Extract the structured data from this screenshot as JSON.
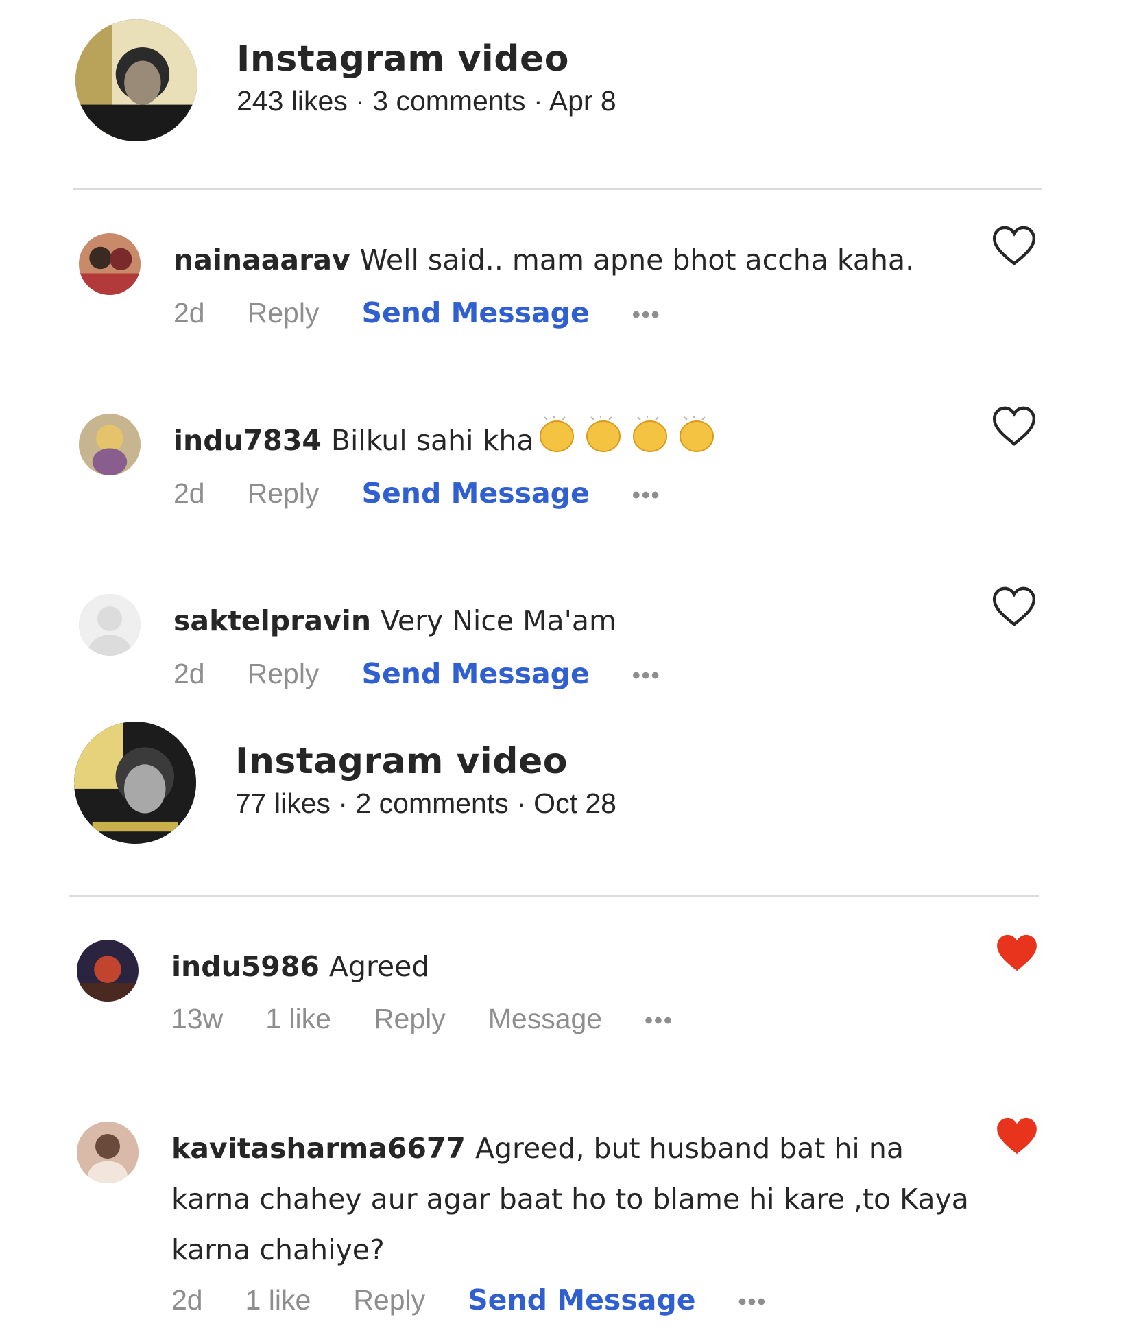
{
  "posts": [
    {
      "title": "Instagram video",
      "meta": "243 likes · 3 comments · Apr 8",
      "comments": [
        {
          "username": "nainaaarav",
          "text": "Well said.. mam apne bhot accha kaha.",
          "time": "2d",
          "likes": "",
          "reply": "Reply",
          "message": "Send Message",
          "more": "•••",
          "liked": false
        },
        {
          "username": "indu7834",
          "text": "Bilkul sahi kha",
          "emoji": "clapping-hands",
          "time": "2d",
          "likes": "",
          "reply": "Reply",
          "message": "Send Message",
          "more": "•••",
          "liked": false
        },
        {
          "username": "saktelpravin",
          "text": "Very Nice Ma'am",
          "time": "2d",
          "likes": "",
          "reply": "Reply",
          "message": "Send Message",
          "more": "•••",
          "liked": false
        }
      ]
    },
    {
      "title": "Instagram video",
      "meta": "77 likes · 2 comments · Oct 28",
      "comments": [
        {
          "username": "indu5986",
          "text": "Agreed",
          "time": "13w",
          "likes": "1 like",
          "reply": "Reply",
          "message": "Message",
          "more": "•••",
          "liked": true
        },
        {
          "username": "kavitasharma6677",
          "text": "Agreed, but husband bat hi na karna chahey aur agar baat ho to blame hi kare ,to Kaya karna chahiye?",
          "time": "2d",
          "likes": "1 like",
          "reply": "Reply",
          "message": "Send Message",
          "more": "•••",
          "liked": true
        }
      ]
    }
  ],
  "colors": {
    "link": "#2f5fd0",
    "muted": "#8e8e8e",
    "heart_liked": "#ed4956",
    "text": "#262626"
  }
}
